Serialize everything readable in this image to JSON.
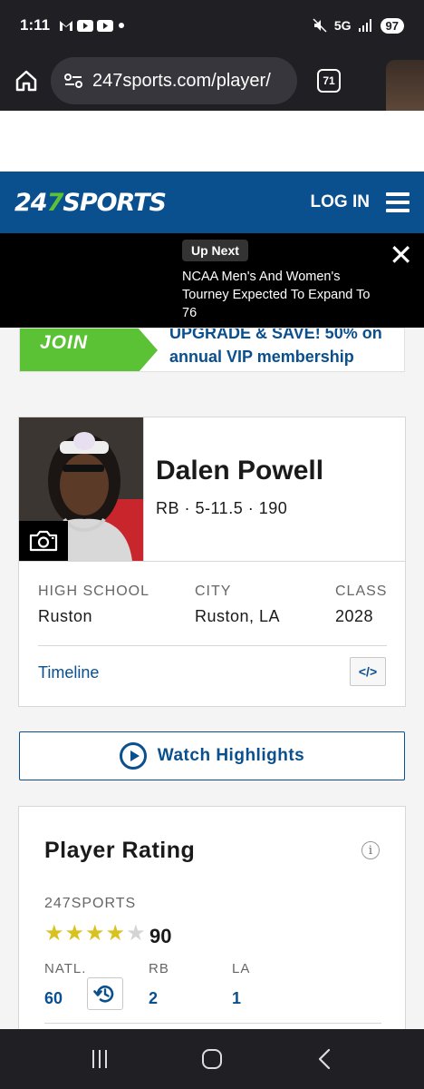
{
  "status_bar": {
    "time": "1:11",
    "network": "5G",
    "battery": "97"
  },
  "browser": {
    "url": "247sports.com/player/",
    "tab_count": "71"
  },
  "header": {
    "logo_prefix": "24",
    "logo_seven": "7",
    "logo_suffix": "SPORTS",
    "login_label": "LOG IN"
  },
  "up_next": {
    "badge": "Up Next",
    "headline": "NCAA Men's And Women's Tourney Expected To Expand To 76"
  },
  "join_banner": {
    "label": "JOIN",
    "promo": "UPGRADE & SAVE! 50% on annual VIP membership"
  },
  "player": {
    "name": "Dalen Powell",
    "meta": "RB · 5-11.5 · 190",
    "high_school_label": "HIGH SCHOOL",
    "high_school": "Ruston",
    "city_label": "CITY",
    "city": "Ruston, LA",
    "class_label": "CLASS",
    "class": "2028",
    "timeline_label": "Timeline",
    "embed_label": "</>"
  },
  "highlights": {
    "label": "Watch Highlights"
  },
  "rating": {
    "title": "Player Rating",
    "info": "i",
    "source": "247SPORTS",
    "stars": 4,
    "stars_max": 5,
    "score": "90",
    "natl_label": "NATL.",
    "natl_value": "60",
    "pos_label": "RB",
    "pos_value": "2",
    "state_label": "LA",
    "state_value": "1"
  },
  "colors": {
    "brand_blue": "#0a4f8e",
    "brand_green": "#5bc236",
    "star_gold": "#d9c21f"
  }
}
